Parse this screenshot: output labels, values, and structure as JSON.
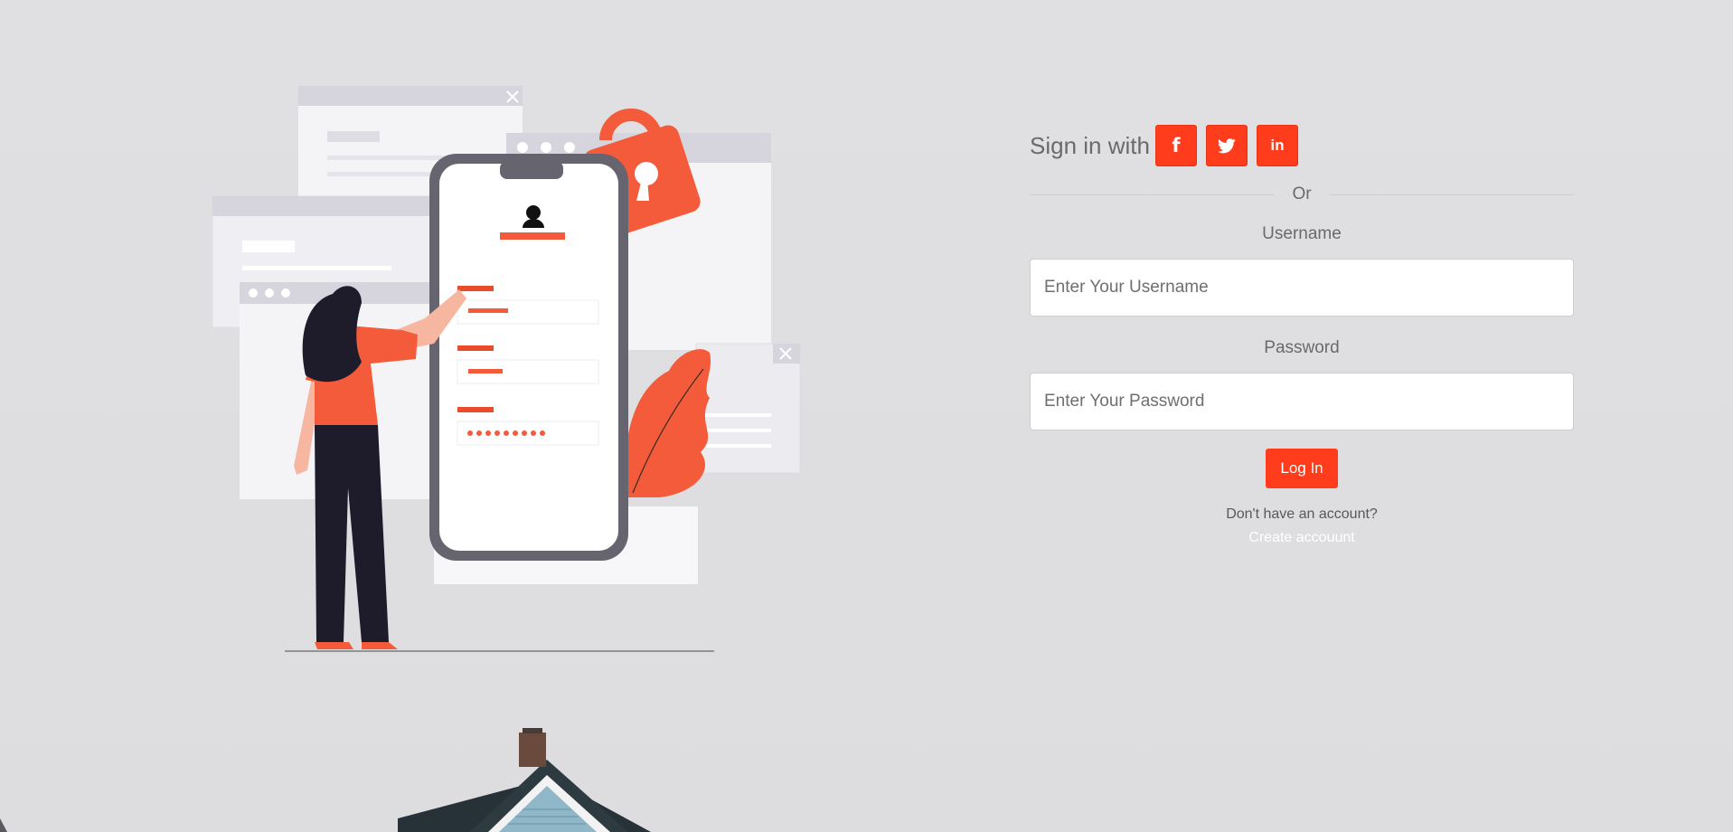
{
  "signin": {
    "label": "Sign in with",
    "social": [
      {
        "name": "facebook-icon",
        "glyph": "f"
      },
      {
        "name": "twitter-icon",
        "glyph": "t"
      },
      {
        "name": "linkedin-icon",
        "glyph": "in"
      }
    ]
  },
  "divider": {
    "text": "Or"
  },
  "username": {
    "label": "Username",
    "placeholder": "Enter Your Username"
  },
  "password": {
    "label": "Password",
    "placeholder": "Enter Your Password"
  },
  "login_button": "Log In",
  "account_prompt": "Don't have an account?",
  "create_account": "Create accouunt",
  "colors": {
    "accent": "#ff3d1c",
    "background": "#e0e0e2",
    "text": "#6a6a6e"
  }
}
